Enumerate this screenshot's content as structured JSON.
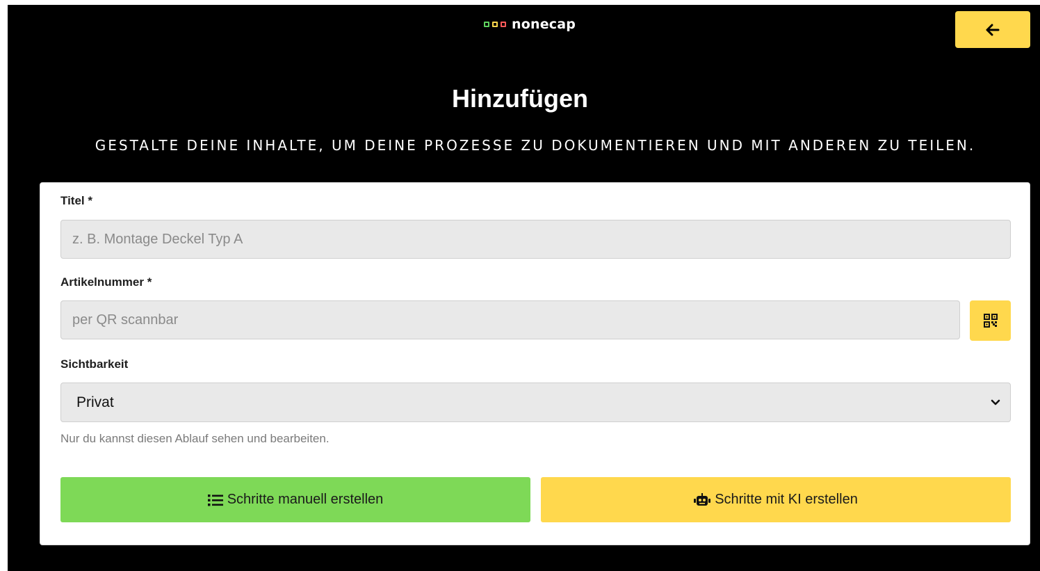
{
  "brand": {
    "name": "nonecap",
    "square_colors": [
      "#5fd35f",
      "#ffd84d",
      "#ff5a5a"
    ]
  },
  "header": {
    "back_icon": "arrow-left-icon",
    "title": "Hinzufügen",
    "subtitle": "GESTALTE DEINE INHALTE, UM DEINE PROZESSE ZU DOKUMENTIEREN UND MIT ANDEREN ZU TEILEN."
  },
  "form": {
    "title_label": "Titel *",
    "title_placeholder": "z. B. Montage Deckel Typ A",
    "article_label": "Artikelnummer *",
    "article_placeholder": "per QR scannbar",
    "qr_icon": "qr-code-icon",
    "visibility_label": "Sichtbarkeit",
    "visibility_value": "Privat",
    "visibility_hint": "Nur du kannst diesen Ablauf sehen und bearbeiten."
  },
  "actions": {
    "manual_label": "Schritte manuell erstellen",
    "manual_icon": "list-icon",
    "ai_label": "Schritte mit KI erstellen",
    "ai_icon": "robot-icon"
  },
  "colors": {
    "accent_yellow": "#ffd84d",
    "accent_green": "#7ed957",
    "background": "#000000"
  }
}
